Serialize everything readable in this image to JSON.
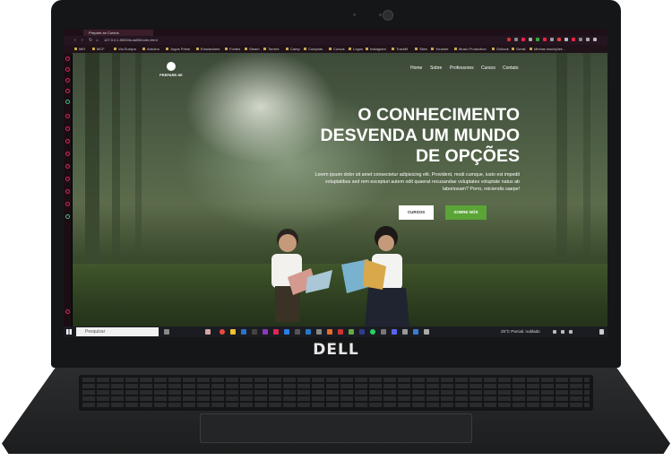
{
  "browser": {
    "tab_title": "Prepare-se Cursos",
    "url": "127.0.0.1:5500/Aula05/index.html",
    "bookmarks": [
      "MEI",
      "MCF",
      "Via Europa",
      "Arduino",
      "Jogos Prime",
      "Emuladores",
      "Fontes",
      "Steam",
      "Torrent",
      "Camp",
      "Compras",
      "Cursos",
      "Logos",
      "Instagram",
      "Trackfit",
      "Sites",
      "Youtube",
      "Music Production",
      "Outlook",
      "Gmail",
      "Minhas inscrições -"
    ]
  },
  "site": {
    "logo_text": "PREPARE-SE",
    "menu": [
      "Home",
      "Sobre",
      "Professores",
      "Cursos",
      "Contato"
    ],
    "hero_title": [
      "O CONHECIMENTO",
      "DESVENDA UM MUNDO",
      "DE OPÇÕES"
    ],
    "hero_text": "Lorem ipsum dolor sit amet consectetur adipisicing elit. Provident, modi cumque, iusto est impedit voluptatibus sed rem excepturi autem odit quaerat recusandae voluptates voluptate natus ab laboriosam? Porro, reiciendis saepe!",
    "btn_cursos": "CURSOS",
    "btn_sobre": "SOBRE NÓS"
  },
  "taskbar": {
    "search_placeholder": "Pesquisar",
    "weather": "25°C  Parcial. nublado"
  },
  "laptop": {
    "brand": "DELL"
  },
  "colors": {
    "accent_green": "#5aa536",
    "opera_red": "#e2245a"
  }
}
